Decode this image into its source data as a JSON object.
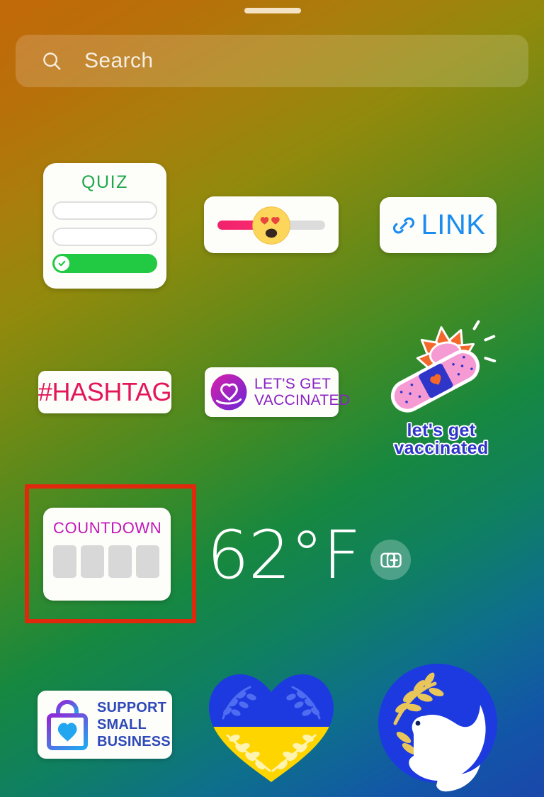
{
  "screen": {
    "name": "instagram-story-sticker-tray",
    "background_gradient_start": "#c2690a",
    "background_gradient_mid": "#17883f",
    "background_gradient_end": "#1a47ab"
  },
  "drag_handle": {
    "name": "drag-handle",
    "color": "#f3e2c4"
  },
  "search": {
    "placeholder": "Search",
    "icon": "search-icon",
    "text_color": "#f7eee0",
    "background": "rgba(255,255,255,0.17)"
  },
  "stickers": {
    "quiz": {
      "title": "QUIZ",
      "title_color": "#1fa84a",
      "option_count": 2,
      "answer_color": "#22c943",
      "check_icon": "check-circle-icon"
    },
    "emoji_slider": {
      "emoji": "heart-eyes-emoji",
      "fill_percent": 47,
      "fill_color": "#f0226c",
      "track_color": "#dcdcdc"
    },
    "link": {
      "label": "LINK",
      "color": "#1a8cf0",
      "icon": "chain-link-icon"
    },
    "hashtag": {
      "label": "#HASHTAG",
      "color": "#e3165b"
    },
    "vaccinated_badge": {
      "line1": "LET'S GET",
      "line2": "VACCINATED",
      "color": "#8a22c4",
      "icon": "heart-ribbon-icon"
    },
    "flower_bandage": {
      "line1": "let's get",
      "line2": "vaccinated",
      "caption_color": "#2e35c8",
      "icon": "flower-bandage-icon"
    },
    "countdown": {
      "title": "COUNTDOWN",
      "title_color": "#c215b8",
      "digit_box_count": 4,
      "digit_box_color": "#d8d8d8",
      "highlighted": true,
      "highlight_color": "#e0280d"
    },
    "temperature": {
      "value": "62°F",
      "color": "#ffffff"
    },
    "add_yours": {
      "icon": "add-yours-stacked-cards-plus-icon",
      "background": "rgba(255,255,255,0.26)"
    },
    "small_business": {
      "line1": "SUPPORT",
      "line2": "SMALL",
      "line3": "BUSINESS",
      "color": "#2f4ab8",
      "icon": "shopping-bag-heart-icon"
    },
    "ukraine_heart": {
      "icon": "ukraine-flag-heart-icon",
      "top_color": "#1d3ae0",
      "bottom_color": "#ffd500"
    },
    "peace_dove": {
      "icon": "peace-dove-icon",
      "circle_color": "#1d3ae0",
      "branch_color": "#e8c65a"
    }
  }
}
